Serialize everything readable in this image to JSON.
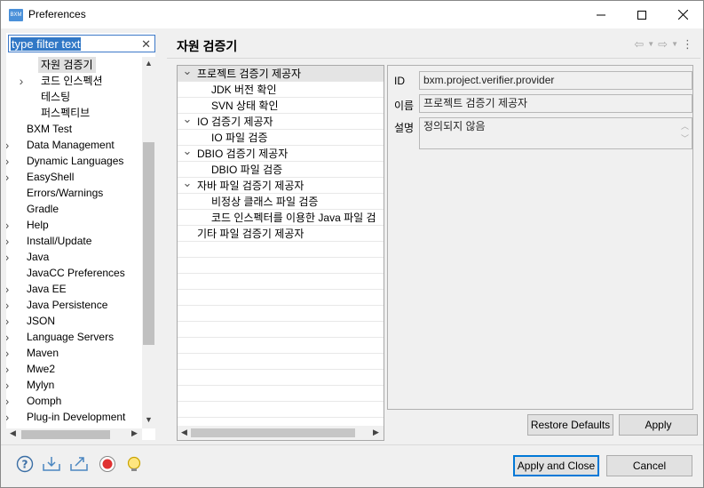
{
  "window": {
    "title": "Preferences",
    "app_icon_text": "BXM",
    "minimize_icon": "minimize-icon",
    "maximize_icon": "maximize-icon",
    "close_icon": "close-icon"
  },
  "filter": {
    "value": "type filter text",
    "clear_icon": "clear-icon"
  },
  "tree": [
    {
      "label": "자원 검증기",
      "indent": 2,
      "expander": "",
      "selected": true
    },
    {
      "label": "코드 인스펙션",
      "indent": 2,
      "expander": ">",
      "selected": false
    },
    {
      "label": "테스팅",
      "indent": 2,
      "expander": "",
      "selected": false
    },
    {
      "label": "퍼스펙티브",
      "indent": 2,
      "expander": "",
      "selected": false
    },
    {
      "label": "BXM Test",
      "indent": 1,
      "expander": "",
      "selected": false
    },
    {
      "label": "Data Management",
      "indent": 1,
      "expander": ">",
      "selected": false
    },
    {
      "label": "Dynamic Languages",
      "indent": 1,
      "expander": ">",
      "selected": false
    },
    {
      "label": "EasyShell",
      "indent": 1,
      "expander": ">",
      "selected": false
    },
    {
      "label": "Errors/Warnings",
      "indent": 1,
      "expander": "",
      "selected": false
    },
    {
      "label": "Gradle",
      "indent": 1,
      "expander": "",
      "selected": false
    },
    {
      "label": "Help",
      "indent": 1,
      "expander": ">",
      "selected": false
    },
    {
      "label": "Install/Update",
      "indent": 1,
      "expander": ">",
      "selected": false
    },
    {
      "label": "Java",
      "indent": 1,
      "expander": ">",
      "selected": false
    },
    {
      "label": "JavaCC Preferences",
      "indent": 1,
      "expander": "",
      "selected": false
    },
    {
      "label": "Java EE",
      "indent": 1,
      "expander": ">",
      "selected": false
    },
    {
      "label": "Java Persistence",
      "indent": 1,
      "expander": ">",
      "selected": false
    },
    {
      "label": "JSON",
      "indent": 1,
      "expander": ">",
      "selected": false
    },
    {
      "label": "Language Servers",
      "indent": 1,
      "expander": ">",
      "selected": false
    },
    {
      "label": "Maven",
      "indent": 1,
      "expander": ">",
      "selected": false
    },
    {
      "label": "Mwe2",
      "indent": 1,
      "expander": ">",
      "selected": false
    },
    {
      "label": "Mylyn",
      "indent": 1,
      "expander": ">",
      "selected": false
    },
    {
      "label": "Oomph",
      "indent": 1,
      "expander": ">",
      "selected": false
    },
    {
      "label": "Plug-in Development",
      "indent": 1,
      "expander": ">",
      "selected": false
    }
  ],
  "page": {
    "title": "자원 검증기",
    "back_icon": "back-arrow-icon",
    "forward_icon": "forward-arrow-icon",
    "menu_icon": "view-menu-icon"
  },
  "providers": [
    {
      "label": "프로젝트 검증기 제공자",
      "level": 0,
      "expander": "v",
      "highlight": true
    },
    {
      "label": "JDK 버전 확인",
      "level": 1,
      "expander": "",
      "highlight": false
    },
    {
      "label": "SVN 상태 확인",
      "level": 1,
      "expander": "",
      "highlight": false
    },
    {
      "label": "IO 검증기 제공자",
      "level": 0,
      "expander": "v",
      "highlight": false
    },
    {
      "label": "IO 파일 검증",
      "level": 1,
      "expander": "",
      "highlight": false
    },
    {
      "label": "DBIO 검증기 제공자",
      "level": 0,
      "expander": "v",
      "highlight": false
    },
    {
      "label": "DBIO 파일 검증",
      "level": 1,
      "expander": "",
      "highlight": false
    },
    {
      "label": "자바 파일 검증기 제공자",
      "level": 0,
      "expander": "v",
      "highlight": false
    },
    {
      "label": "비정상 클래스 파일 검증",
      "level": 1,
      "expander": "",
      "highlight": false
    },
    {
      "label": "코드 인스펙터를 이용한 Java 파일 검",
      "level": 1,
      "expander": "",
      "highlight": false
    },
    {
      "label": "기타 파일 검증기 제공자",
      "level": 0,
      "expander": "",
      "highlight": false
    }
  ],
  "details": {
    "id_label": "ID",
    "id_value": "bxm.project.verifier.provider",
    "name_label": "이름",
    "name_value": "프로젝트 검증기 제공자",
    "desc_label": "설명",
    "desc_value": "정의되지 않음"
  },
  "buttons": {
    "restore_defaults": "Restore Defaults",
    "apply": "Apply",
    "apply_and_close": "Apply and Close",
    "cancel": "Cancel"
  },
  "bottom_icons": [
    "help-icon",
    "import-icon",
    "export-icon",
    "record-icon",
    "tip-icon"
  ],
  "colors": {
    "selection": "#3178c6",
    "accent": "#0078d7",
    "record": "#e03030"
  }
}
